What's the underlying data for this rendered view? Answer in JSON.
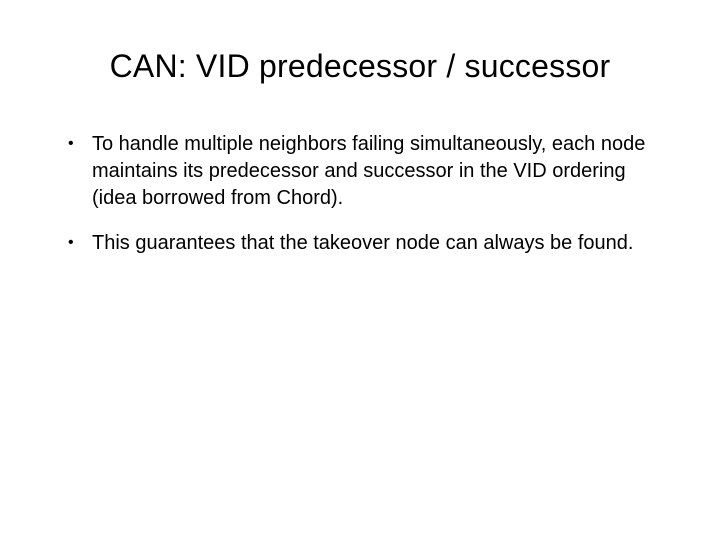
{
  "slide": {
    "title": "CAN: VID predecessor / successor",
    "bullets": [
      "To handle multiple neighbors failing simultaneously, each node maintains its predecessor and successor in the VID ordering (idea borrowed from Chord).",
      "This guarantees that the takeover node can always be found."
    ]
  }
}
